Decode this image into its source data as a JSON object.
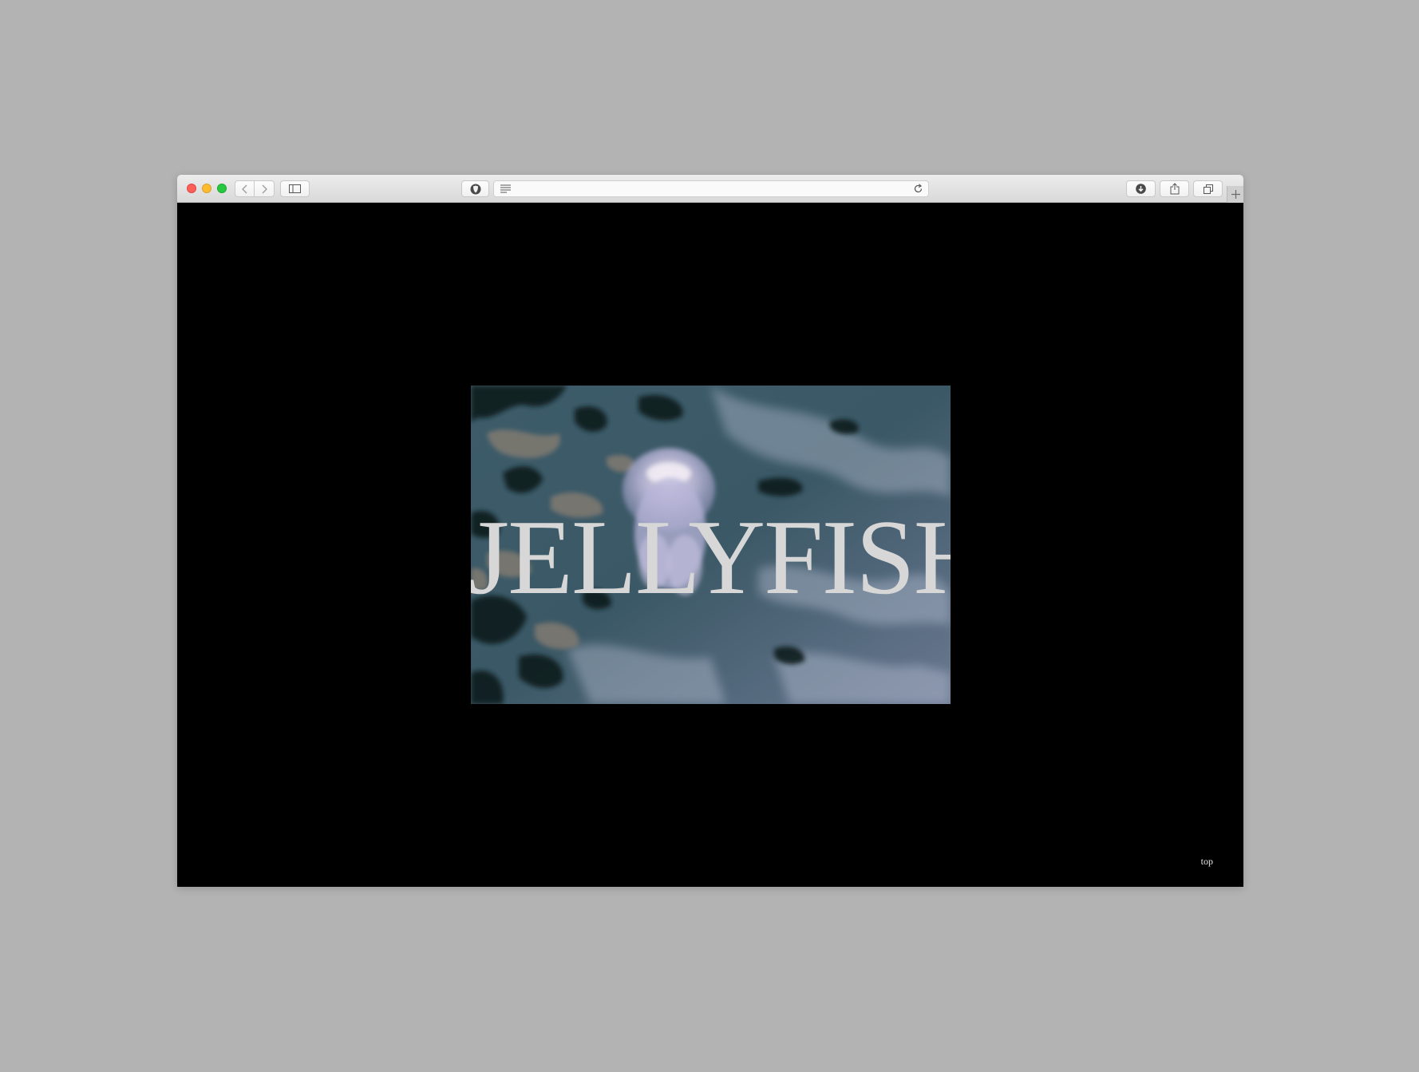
{
  "browser": {
    "address_value": "",
    "toolbar_buttons": [
      "back-icon",
      "forward-icon",
      "sidebar-icon",
      "privacy-icon",
      "reader-icon",
      "reload-icon",
      "downloads-icon",
      "share-icon",
      "tabs-overview-icon",
      "new-tab-icon"
    ]
  },
  "page": {
    "hero_title": "JELLYFISH",
    "top_link": "top"
  },
  "colors": {
    "desktop": "#b3b3b3",
    "page_background": "#000000",
    "title_text": "#d7d7d7",
    "water": "#3b5866"
  }
}
